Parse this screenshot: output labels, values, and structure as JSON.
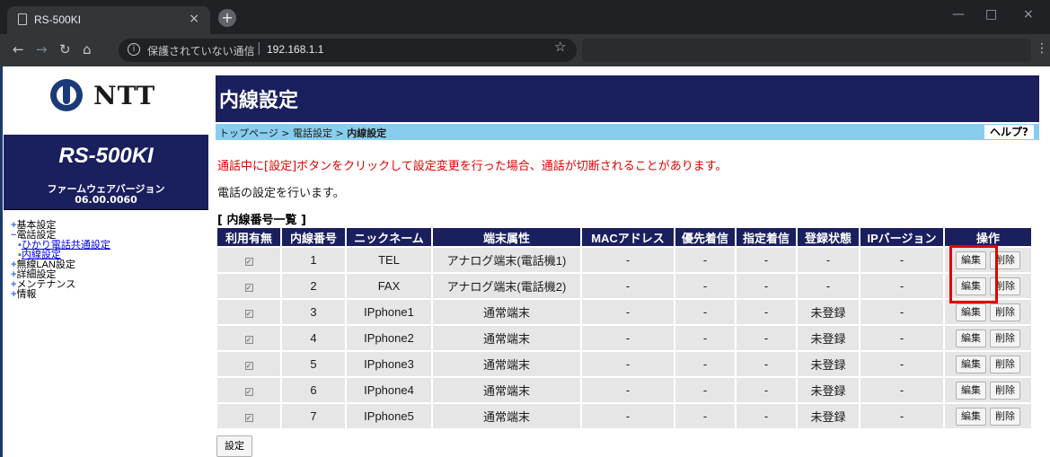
{
  "browser": {
    "tab_title": "RS-500KI",
    "tab_close": "×",
    "new_tab": "+",
    "url_warning": "保護されていない通信",
    "url_host": "192.168.1.1",
    "minimize": "—",
    "maximize": "□",
    "close": "×"
  },
  "brand": {
    "logo_text": "NTT"
  },
  "device": {
    "model": "RS-500KI",
    "fw_label": "ファームウェアバージョン",
    "fw_version": "06.00.0060"
  },
  "sidebar": {
    "basic": "基本設定",
    "phone": "電話設定",
    "phone_items": [
      "ひかり電話共通設定",
      "内線設定"
    ],
    "wlan": "無線LAN設定",
    "detail": "詳細設定",
    "maintenance": "メンテナンス",
    "info": "情報"
  },
  "page": {
    "title": "内線設定",
    "breadcrumb_top": "トップページ",
    "breadcrumb_sep1": " > ",
    "breadcrumb_phone": "電話設定",
    "breadcrumb_sep2": " > ",
    "breadcrumb_current": "内線設定",
    "help": "ヘルプ?",
    "warning": "通話中に[設定]ボタンをクリックして設定変更を行った場合、通話が切断されることがあります。",
    "description": "電話の設定を行います。",
    "list_title": "[ 内線番号一覧 ]",
    "set_button": "設定"
  },
  "table": {
    "headers": [
      "利用有無",
      "内線番号",
      "ニックネーム",
      "端末属性",
      "MACアドレス",
      "優先着信",
      "指定着信",
      "登録状態",
      "IPバージョン",
      "操作"
    ],
    "edit_label": "編集",
    "delete_label": "削除",
    "check_mark": "✓",
    "rows": [
      {
        "num": "1",
        "nick": "TEL",
        "attr": "アナログ端末(電話機1)",
        "mac": "-",
        "prio": "-",
        "spec": "-",
        "reg": "-",
        "ipv": "-"
      },
      {
        "num": "2",
        "nick": "FAX",
        "attr": "アナログ端末(電話機2)",
        "mac": "-",
        "prio": "-",
        "spec": "-",
        "reg": "-",
        "ipv": "-"
      },
      {
        "num": "3",
        "nick": "IPphone1",
        "attr": "通常端末",
        "mac": "-",
        "prio": "-",
        "spec": "-",
        "reg": "未登録",
        "ipv": "-"
      },
      {
        "num": "4",
        "nick": "IPphone2",
        "attr": "通常端末",
        "mac": "-",
        "prio": "-",
        "spec": "-",
        "reg": "未登録",
        "ipv": "-"
      },
      {
        "num": "5",
        "nick": "IPphone3",
        "attr": "通常端末",
        "mac": "-",
        "prio": "-",
        "spec": "-",
        "reg": "未登録",
        "ipv": "-"
      },
      {
        "num": "6",
        "nick": "IPphone4",
        "attr": "通常端末",
        "mac": "-",
        "prio": "-",
        "spec": "-",
        "reg": "未登録",
        "ipv": "-"
      },
      {
        "num": "7",
        "nick": "IPphone5",
        "attr": "通常端末",
        "mac": "-",
        "prio": "-",
        "spec": "-",
        "reg": "未登録",
        "ipv": "-"
      }
    ]
  },
  "colors": {
    "header_navy": "#1a1f5e",
    "breadcrumb_blue": "#87cdee",
    "warning_red": "#e60000",
    "highlight_red": "#e00000"
  }
}
